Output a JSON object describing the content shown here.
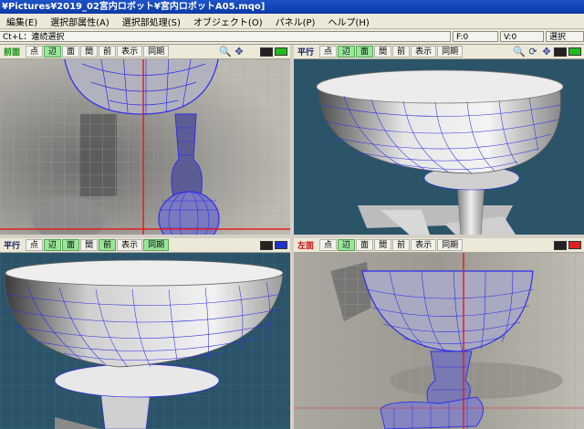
{
  "window": {
    "title": "¥Pictures¥2019_02宮内ロボット¥宮内ロボットA05.mqo]"
  },
  "menu": [
    "編集(E)",
    "選択部属性(A)",
    "選択部処理(S)",
    "オブジェクト(O)",
    "パネル(P)",
    "ヘルプ(H)"
  ],
  "status": {
    "hint": "Ct+L：連続選択",
    "faces": "F:0",
    "vertices": "V:0",
    "pending": "選択"
  },
  "panes": {
    "top_left": {
      "title": "前面",
      "buttons": [
        {
          "label": "点",
          "on": false
        },
        {
          "label": "辺",
          "on": true
        },
        {
          "label": "面",
          "on": false
        },
        {
          "label": "間",
          "on": false
        },
        {
          "label": "前",
          "on": false
        },
        {
          "label": "表示",
          "on": false
        },
        {
          "label": "同期",
          "on": false
        }
      ],
      "color": "#22bb22"
    },
    "top_right": {
      "title": "平行",
      "buttons": [
        {
          "label": "点",
          "on": false
        },
        {
          "label": "辺",
          "on": true
        },
        {
          "label": "面",
          "on": true
        },
        {
          "label": "間",
          "on": false
        },
        {
          "label": "前",
          "on": false
        },
        {
          "label": "表示",
          "on": false
        },
        {
          "label": "同期",
          "on": false
        }
      ],
      "color": "#22bb22"
    },
    "bottom_left": {
      "title": "平行",
      "buttons": [
        {
          "label": "点",
          "on": false
        },
        {
          "label": "辺",
          "on": true
        },
        {
          "label": "面",
          "on": true
        },
        {
          "label": "間",
          "on": false
        },
        {
          "label": "前",
          "on": true
        },
        {
          "label": "表示",
          "on": false
        },
        {
          "label": "同期",
          "on": true
        }
      ],
      "color": "#2233cc"
    },
    "bottom_right": {
      "title": "左面",
      "buttons": [
        {
          "label": "点",
          "on": false
        },
        {
          "label": "辺",
          "on": true
        },
        {
          "label": "面",
          "on": false
        },
        {
          "label": "間",
          "on": false
        },
        {
          "label": "前",
          "on": false
        },
        {
          "label": "表示",
          "on": false
        },
        {
          "label": "同期",
          "on": false
        }
      ],
      "color": "#dd2222"
    }
  }
}
